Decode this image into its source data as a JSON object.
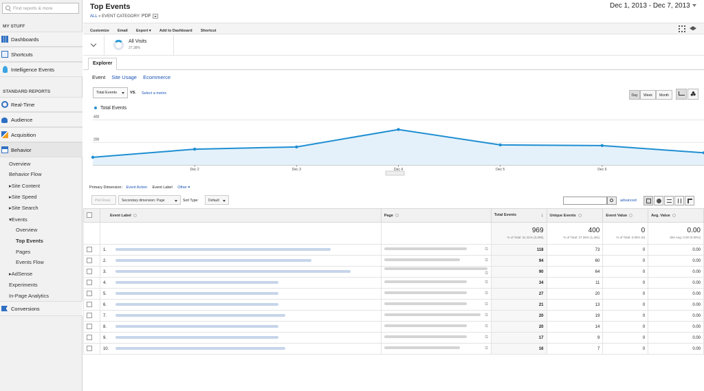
{
  "sidebar": {
    "search_placeholder": "Find reports & more",
    "my_stuff_header": "MY STUFF",
    "my_stuff": [
      {
        "label": "Dashboards",
        "icon": "dashboards-icon"
      },
      {
        "label": "Shortcuts",
        "icon": "shortcuts-icon"
      },
      {
        "label": "Intelligence Events",
        "icon": "intelligence-events-icon"
      }
    ],
    "standard_header": "STANDARD REPORTS",
    "standard": [
      {
        "label": "Real-Time",
        "icon": "realtime-icon"
      },
      {
        "label": "Audience",
        "icon": "audience-icon"
      },
      {
        "label": "Acquisition",
        "icon": "acquisition-icon"
      },
      {
        "label": "Behavior",
        "icon": "behavior-icon"
      }
    ],
    "behavior_items": [
      "Overview",
      "Behavior Flow",
      "Site Content",
      "Site Speed",
      "Site Search",
      "Events"
    ],
    "events_items": [
      "Overview",
      "Top Events",
      "Pages",
      "Events Flow"
    ],
    "more_items": [
      "AdSense",
      "Experiments",
      "In-Page Analytics"
    ],
    "conversions": "Conversions"
  },
  "header": {
    "title": "Top Events",
    "breadcrumb_all": "ALL",
    "breadcrumb_sep": "»",
    "breadcrumb_cat": "EVENT CATEGORY:",
    "breadcrumb_value": "PDF",
    "date_range": "Dec 1, 2013 - Dec 7, 2013"
  },
  "toolbar": [
    "Customize",
    "Email",
    "Export ▾",
    "Add to Dashboard",
    "Shortcut"
  ],
  "segment": {
    "name": "All Visits",
    "pct": "27.38%"
  },
  "tabs": {
    "explorer": "Explorer"
  },
  "subtabs": [
    "Event",
    "Site Usage",
    "Ecommerce"
  ],
  "metric": {
    "selected": "Total Events",
    "vs": "VS.",
    "select_metric": "Select a metric"
  },
  "granularity": [
    "Day",
    "Week",
    "Month"
  ],
  "colors": {
    "line": "#1e8ed2",
    "fill": "#e4f1fa",
    "link": "#1a53b5"
  },
  "chart_data": {
    "type": "line",
    "x": [
      "Dec 1",
      "Dec 2",
      "Dec 3",
      "Dec 4",
      "Dec 5",
      "Dec 6",
      "Dec 7"
    ],
    "x_tick_labels": [
      "Dec 2",
      "Dec 3",
      "Dec 4",
      "Dec 5",
      "Dec 6"
    ],
    "series": [
      {
        "name": "Total Events",
        "values": [
          68,
          140,
          160,
          315,
          178,
          172,
          108
        ]
      }
    ],
    "y_ticks": [
      "200",
      "400"
    ],
    "ylim": [
      0,
      440
    ],
    "grid": true,
    "legend": "top-left"
  },
  "dimension": {
    "label": "Primary Dimension:",
    "options": [
      "Event Action",
      "Event Label",
      "Other ▾"
    ]
  },
  "controls": {
    "plot_rows": "Plot Rows",
    "secondary": "Secondary dimension: Page",
    "sort_label": "Sort Type:",
    "sort_value": "Default",
    "advanced": "advanced"
  },
  "table": {
    "headers": [
      "Event Label",
      "Page",
      "Total Events",
      "Unique Events",
      "Event Value",
      "Avg. Value"
    ],
    "totals": {
      "total_events": "969",
      "total_events_sub": "% of Total: 31.31% (3,095)",
      "unique_events": "400",
      "unique_events_sub": "% of Total: 27.38% (1,461)",
      "event_value": "0",
      "event_value_sub": "% of Total: 0.00% (0)",
      "avg_value": "0.00",
      "avg_value_sub": "Site Avg: 0.00 (0.00%)"
    },
    "rows": [
      {
        "n": "1.",
        "total": "118",
        "unique": "73",
        "value": "0",
        "avg": "0.00"
      },
      {
        "n": "2.",
        "total": "94",
        "unique": "60",
        "value": "0",
        "avg": "0.00"
      },
      {
        "n": "3.",
        "total": "90",
        "unique": "64",
        "value": "0",
        "avg": "0.00"
      },
      {
        "n": "4.",
        "total": "34",
        "unique": "11",
        "value": "0",
        "avg": "0.00"
      },
      {
        "n": "5.",
        "total": "27",
        "unique": "20",
        "value": "0",
        "avg": "0.00"
      },
      {
        "n": "6.",
        "total": "21",
        "unique": "13",
        "value": "0",
        "avg": "0.00"
      },
      {
        "n": "7.",
        "total": "20",
        "unique": "19",
        "value": "0",
        "avg": "0.00"
      },
      {
        "n": "8.",
        "total": "20",
        "unique": "14",
        "value": "0",
        "avg": "0.00"
      },
      {
        "n": "9.",
        "total": "17",
        "unique": "9",
        "value": "0",
        "avg": "0.00"
      },
      {
        "n": "10.",
        "total": "16",
        "unique": "7",
        "value": "0",
        "avg": "0.00"
      }
    ]
  }
}
